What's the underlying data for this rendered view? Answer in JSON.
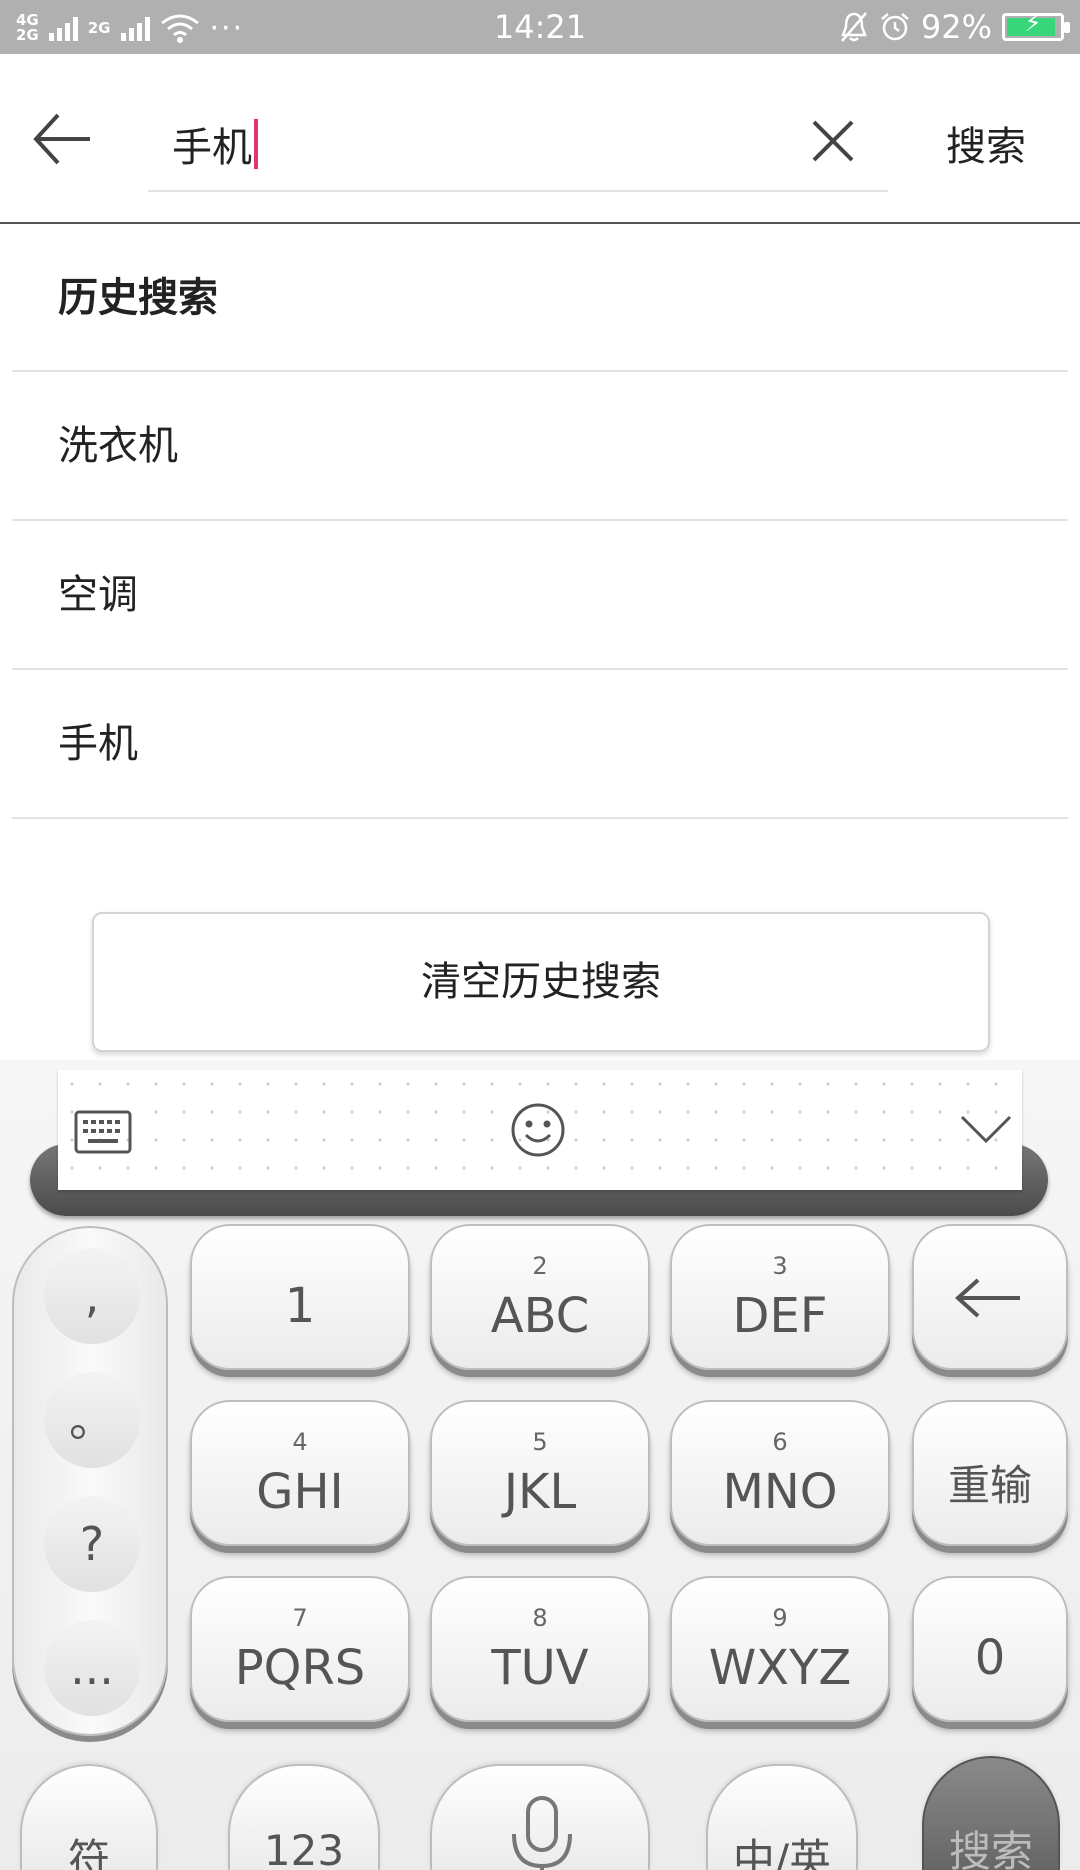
{
  "status_bar": {
    "network_primary": "4G",
    "network_secondary": "2G",
    "network_tertiary": "2G",
    "more": "···",
    "time": "14:21",
    "battery_text": "92%",
    "battery_level": 0.92,
    "battery_color": "#37d67a"
  },
  "search": {
    "query": "手机",
    "submit_label": "搜索",
    "caret_color": "#e0347a",
    "icons": {
      "back": "arrow-left-icon",
      "clear": "close-icon"
    }
  },
  "history": {
    "title": "历史搜索",
    "items": [
      "洗衣机",
      "空调",
      "手机"
    ],
    "clear_label": "清空历史搜索"
  },
  "keyboard": {
    "toolbar_icons": [
      "keyboard-icon",
      "emoji-icon",
      "chevron-down-icon"
    ],
    "punctuation": [
      ",",
      "。",
      "?",
      "..."
    ],
    "keys": [
      {
        "num": "",
        "label": "1"
      },
      {
        "num": "2",
        "label": "ABC"
      },
      {
        "num": "3",
        "label": "DEF"
      },
      {
        "num": "4",
        "label": "GHI"
      },
      {
        "num": "5",
        "label": "JKL"
      },
      {
        "num": "6",
        "label": "MNO"
      },
      {
        "num": "7",
        "label": "PQRS"
      },
      {
        "num": "8",
        "label": "TUV"
      },
      {
        "num": "9",
        "label": "WXYZ"
      }
    ],
    "reinput_label": "重输",
    "zero_label": "0",
    "bottom": {
      "symbols": "符",
      "numbers": "123",
      "lang": "中/英",
      "search": "搜索"
    }
  }
}
